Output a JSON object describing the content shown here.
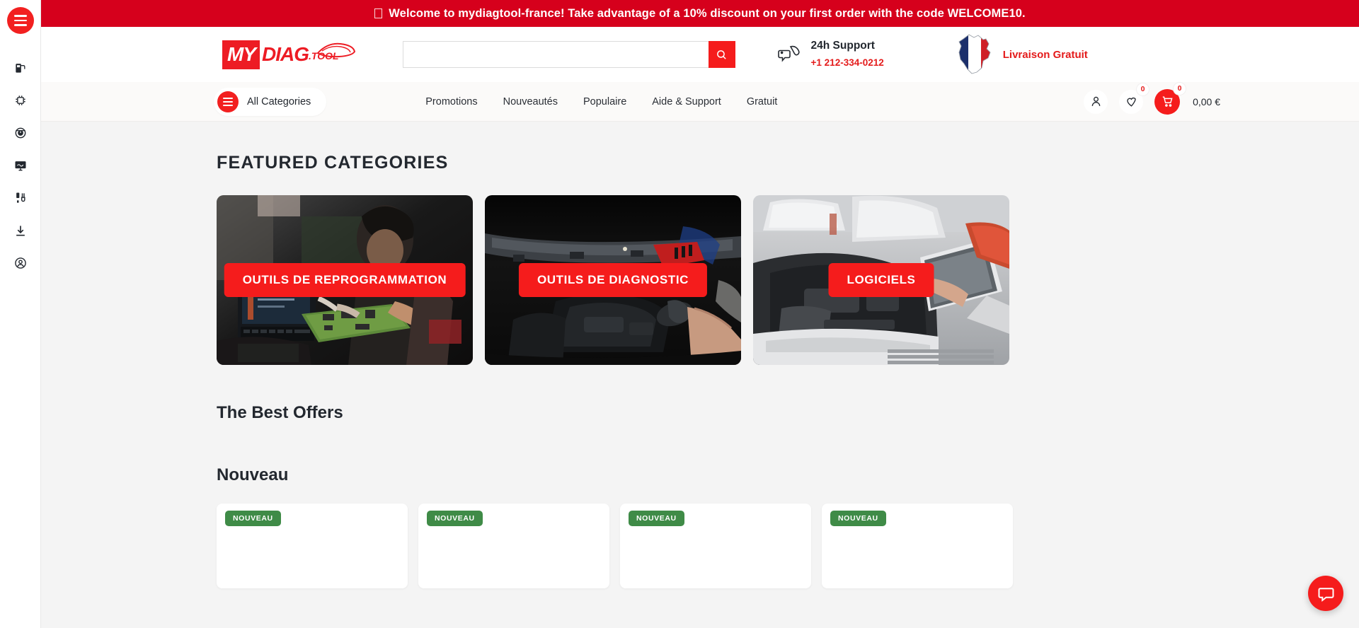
{
  "announcement": {
    "icon": "gift-icon",
    "text": "Welcome to mydiagtool-france! Take advantage of a 10% discount on your first order with the code WELCOME10."
  },
  "rail": {
    "menu_icon": "hamburger-menu-icon",
    "items": [
      {
        "icon": "diagnostic-scanner-icon",
        "name": "rail-item-scanner"
      },
      {
        "icon": "ecu-chip-icon",
        "name": "rail-item-chip"
      },
      {
        "icon": "dashboard-gauge-icon",
        "name": "rail-item-gauge"
      },
      {
        "icon": "monitor-software-icon",
        "name": "rail-item-software"
      },
      {
        "icon": "obd-cable-icon",
        "name": "rail-item-cable"
      },
      {
        "icon": "download-icon",
        "name": "rail-item-download"
      },
      {
        "icon": "user-account-icon",
        "name": "rail-item-account"
      }
    ]
  },
  "header": {
    "logo": {
      "part1": "MY",
      "part2": "DIAG",
      "part3": ".TOOL"
    },
    "search": {
      "value": "",
      "placeholder": "",
      "icon": "search-icon"
    },
    "support": {
      "icon": "phone-support-icon",
      "title": "24h Support",
      "phone": "+1 212-334-0212"
    },
    "shipping": {
      "icon": "france-flag-map-icon",
      "text": "Livraison Gratuit"
    }
  },
  "nav": {
    "all_categories": {
      "label": "All Categories",
      "icon": "hamburger-menu-icon"
    },
    "links": [
      {
        "label": "Promotions"
      },
      {
        "label": "Nouveautés"
      },
      {
        "label": "Populaire"
      },
      {
        "label": "Aide & Support"
      },
      {
        "label": "Gratuit"
      }
    ],
    "account": {
      "icon": "user-icon"
    },
    "wishlist": {
      "icon": "heart-icon",
      "count": "0"
    },
    "cart": {
      "icon": "shopping-cart-icon",
      "count": "0",
      "total": "0,00 €"
    }
  },
  "main": {
    "featured_title": "FEATURED CATEGORIES",
    "categories": [
      {
        "button": "OUTILS DE REPROGRAMMATION",
        "image": "technician-repairing-circuit-board"
      },
      {
        "button": "OUTILS DE DIAGNOSTIC",
        "image": "mechanic-under-car-hood"
      },
      {
        "button": "LOGICIELS",
        "image": "laptop-on-white-car-engine-bay"
      }
    ],
    "best_offers_title": "The Best Offers",
    "nouveau_title": "Nouveau",
    "products": [
      {
        "badge": "NOUVEAU"
      },
      {
        "badge": "NOUVEAU"
      },
      {
        "badge": "NOUVEAU"
      },
      {
        "badge": "NOUVEAU"
      }
    ]
  },
  "chat": {
    "icon": "chat-bubble-icon"
  },
  "colors": {
    "brand_red": "#f51c1c",
    "announce_red": "#d6001c",
    "badge_green": "#3f8b47",
    "page_bg": "#f4f4f4"
  }
}
